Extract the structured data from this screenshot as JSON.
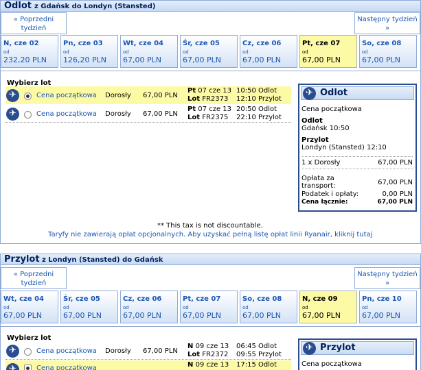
{
  "outbound": {
    "title": "Odlot",
    "route": "z Gdańsk do Londyn (Stansted)",
    "prev_week": "« Poprzedni tydzień",
    "next_week": "Następny tydzień »",
    "days": [
      {
        "name": "N, cze 02",
        "od": "od",
        "price": "232,20 PLN",
        "selected": false
      },
      {
        "name": "Pn, cze 03",
        "od": "od",
        "price": "126,20 PLN",
        "selected": false
      },
      {
        "name": "Wt, cze 04",
        "od": "od",
        "price": "67,00 PLN",
        "selected": false
      },
      {
        "name": "Śr, cze 05",
        "od": "od",
        "price": "67,00 PLN",
        "selected": false
      },
      {
        "name": "Cz, cze 06",
        "od": "od",
        "price": "67,00 PLN",
        "selected": false
      },
      {
        "name": "Pt, cze 07",
        "od": "od",
        "price": "67,00 PLN",
        "selected": true
      },
      {
        "name": "So, cze 08",
        "od": "od",
        "price": "67,00 PLN",
        "selected": false
      }
    ],
    "choose_label": "Wybierz lot",
    "flights": [
      {
        "fare": "Cena początkowa",
        "pax": "Dorosły",
        "price": "67,00 PLN",
        "day": "Pt",
        "date": "07 cze 13",
        "lot": "Lot",
        "flight_no": "FR2373",
        "dep_time": "10:50",
        "dep_label": "Odlot",
        "arr_time": "12:10",
        "arr_label": "Przylot",
        "selected": true
      },
      {
        "fare": "Cena początkowa",
        "pax": "Dorosły",
        "price": "67,00 PLN",
        "day": "Pt",
        "date": "07 cze 13",
        "lot": "Lot",
        "flight_no": "FR2375",
        "dep_time": "20:50",
        "dep_label": "Odlot",
        "arr_time": "22:10",
        "arr_label": "Przylot",
        "selected": false
      }
    ],
    "summary": {
      "title": "Odlot",
      "fare": "Cena początkowa",
      "dep_label": "Odlot",
      "dep_value": "Gdańsk 10:50",
      "arr_label": "Przylot",
      "arr_value": "Londyn (Stansted) 12:10",
      "pax_line": "1 x Dorosły",
      "pax_price": "67,00 PLN",
      "transport_label": "Opłata za transport:",
      "transport_value": "67,00 PLN",
      "tax_label": "Podatek i opłaty:",
      "tax_value": "0,00 PLN",
      "total_label": "Cena łącznie:",
      "total_value": "67,00 PLN"
    },
    "tax_note": "** This tax is not discountable.",
    "fees_note": "Taryfy nie zawierają opłat opcjonalnych. Aby uzyskać pełną listę opłat linii Ryanair, kliknij tutaj"
  },
  "inbound": {
    "title": "Przylot",
    "route": "z Londyn (Stansted) do Gdańsk",
    "prev_week": "« Poprzedni tydzień",
    "next_week": "Następny tydzień »",
    "days": [
      {
        "name": "Wt, cze 04",
        "od": "od",
        "price": "67,00 PLN",
        "selected": false
      },
      {
        "name": "Śr, cze 05",
        "od": "od",
        "price": "67,00 PLN",
        "selected": false
      },
      {
        "name": "Cz, cze 06",
        "od": "od",
        "price": "67,00 PLN",
        "selected": false
      },
      {
        "name": "Pt, cze 07",
        "od": "od",
        "price": "67,00 PLN",
        "selected": false
      },
      {
        "name": "So, cze 08",
        "od": "od",
        "price": "67,00 PLN",
        "selected": false
      },
      {
        "name": "N, cze 09",
        "od": "od",
        "price": "67,00 PLN",
        "selected": true
      },
      {
        "name": "Pn, cze 10",
        "od": "od",
        "price": "67,00 PLN",
        "selected": false
      }
    ],
    "choose_label": "Wybierz lot",
    "flights": [
      {
        "fare": "Cena początkowa",
        "pax": "Dorosły",
        "price": "67,00 PLN",
        "day": "N",
        "date": "09 cze 13",
        "lot": "Lot",
        "flight_no": "FR2372",
        "dep_time": "06:45",
        "dep_label": "Odlot",
        "arr_time": "09:55",
        "arr_label": "Przylot",
        "selected": false
      },
      {
        "fare": "Cena początkowa",
        "pax": "",
        "price": "",
        "day": "N",
        "date": "09 cze 13",
        "lot": "",
        "flight_no": "",
        "dep_time": "17:15",
        "dep_label": "Odlot",
        "arr_time": "",
        "arr_label": "",
        "selected": true
      }
    ],
    "summary": {
      "title": "Przylot",
      "fare": "Cena początkowa"
    }
  }
}
